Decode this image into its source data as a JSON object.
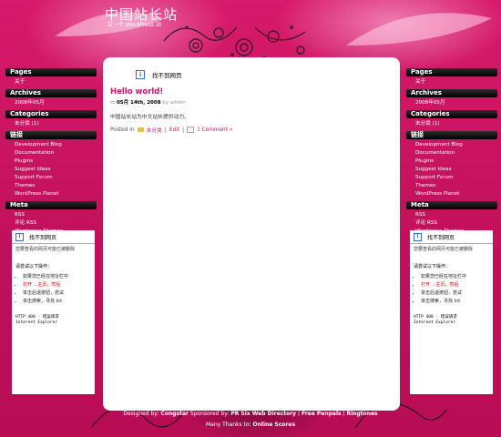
{
  "header": {
    "title": "中国站长站",
    "description": "又一个 WordPress 站"
  },
  "sidebar_left": {
    "widgets": [
      {
        "title": "Pages",
        "items": [
          "关于"
        ]
      },
      {
        "title": "Archives",
        "items": [
          "2008年05月"
        ]
      },
      {
        "title": "Categories",
        "items": [
          "未分类 (1)"
        ]
      },
      {
        "title": "链接",
        "items": [
          "Development Blog",
          "Documentation",
          "Plugins",
          "Suggest Ideas",
          "Support Forum",
          "Themes",
          "WordPress Planet"
        ]
      },
      {
        "title": "Meta",
        "items": [
          "RSS",
          "评论 RSS",
          "Wordpress Themes"
        ]
      }
    ]
  },
  "sidebar_right": {
    "widgets": [
      {
        "title": "Pages",
        "items": [
          "关于"
        ]
      },
      {
        "title": "Archives",
        "items": [
          "2008年05月"
        ]
      },
      {
        "title": "Categories",
        "items": [
          "未分类 (1)"
        ]
      },
      {
        "title": "链接",
        "items": [
          "Development Blog",
          "Documentation",
          "Plugins",
          "Suggest Ideas",
          "Support Forum",
          "Themes",
          "WordPress Planet"
        ]
      },
      {
        "title": "Meta",
        "items": [
          "RSS",
          "评论 RSS",
          "Wordpress Themes"
        ]
      }
    ]
  },
  "error_page": {
    "title": "找不到网页",
    "subtitle": "您要查看的网页可能已被删除",
    "try_label": "请尝试以下操作：",
    "steps": [
      "如果您已经在地址栏中",
      "打开 ...主页，然后",
      "单击后退按钮，尝试",
      "单击搜索，寻找 Int"
    ],
    "code_lines": [
      "HTTP 400 - 错误请求",
      "Internet Explorer"
    ]
  },
  "main": {
    "frame_title": "找不到网页",
    "post": {
      "title": "Hello world!",
      "date": "05月 14th, 2008",
      "author": "by admin",
      "body": "中国站长站为中文站长提供动力。",
      "posted_in": "Posted in",
      "category": "未分类",
      "edit": "Edit",
      "comments": "1 Comment »"
    }
  },
  "footer": {
    "designed_by": "Designed by:",
    "designer": "Congstar",
    "sponsored_by": "Sponsored by:",
    "sponsor1": "PR Six Web Directory",
    "sep": "|",
    "sponsor2": "Free Penpals",
    "sponsor3": "Ringtones",
    "thanks": "Many Thanks to:",
    "thanks_name": "Online Scores"
  },
  "colors": {
    "background": "#c8115f",
    "accent": "#d01468",
    "widget_bar": "#000000"
  }
}
